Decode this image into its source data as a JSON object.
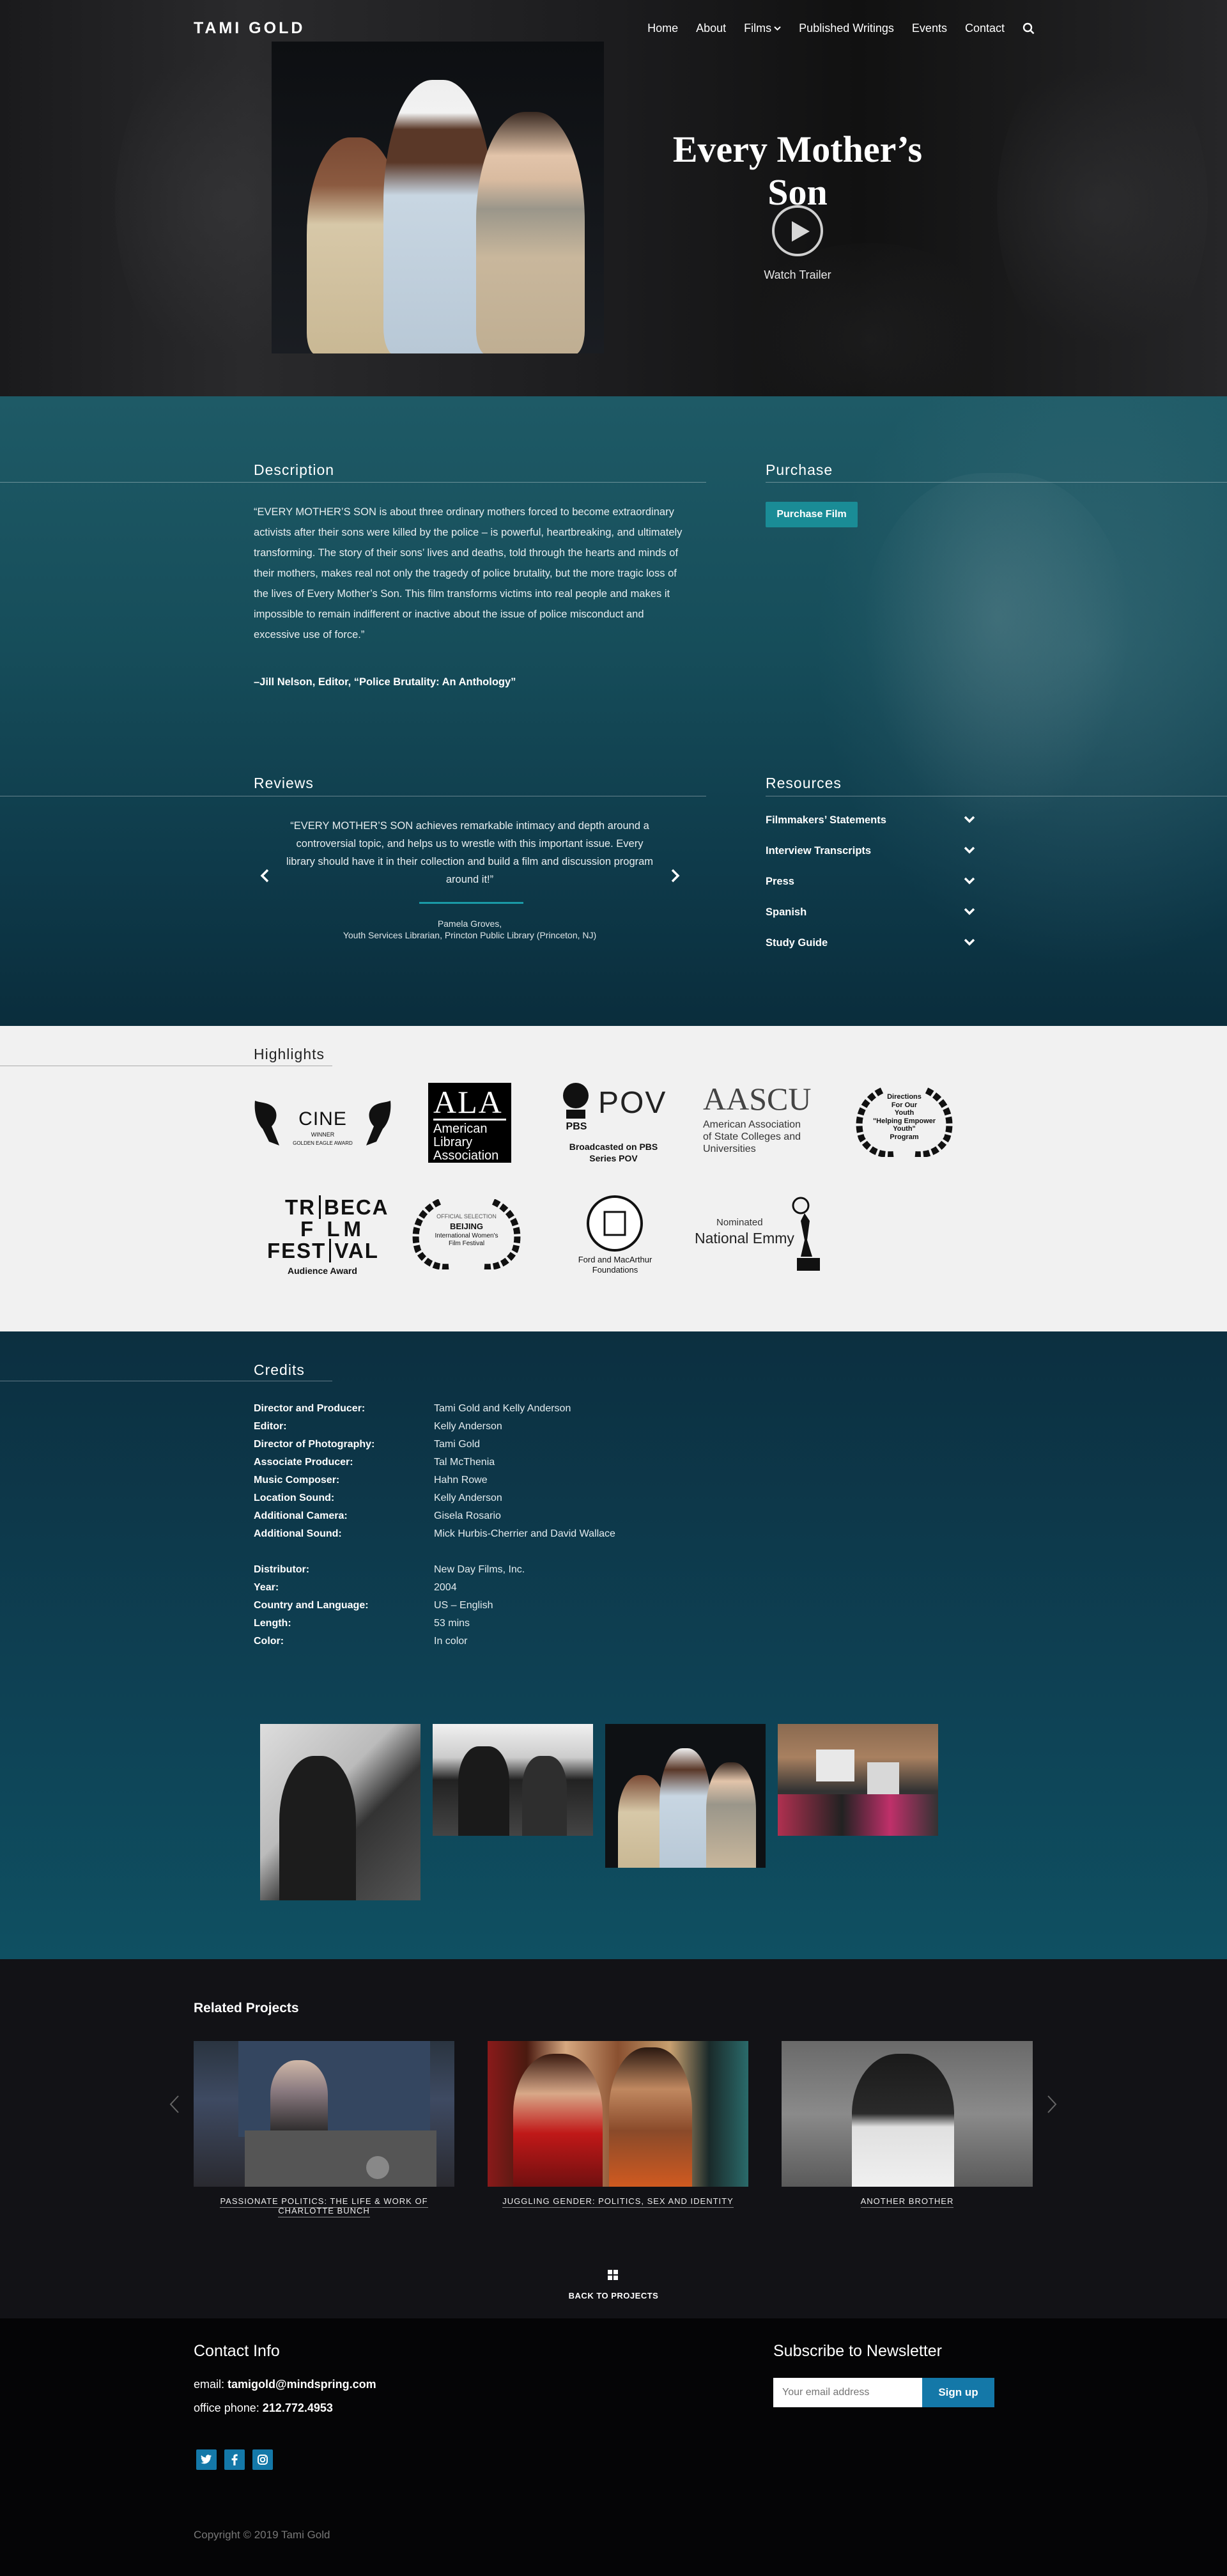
{
  "nav": {
    "logo": "TAMI GOLD",
    "links": [
      "Home",
      "About",
      "Films",
      "Published Writings",
      "Events",
      "Contact"
    ]
  },
  "hero": {
    "title": "Every Mother’s Son",
    "trailer_label": "Watch Trailer"
  },
  "description": {
    "heading": "Description",
    "text": "“EVERY MOTHER’S SON is about three ordinary mothers forced to become extraordinary activists after their sons were killed by the police – is powerful, heartbreaking, and ultimately transforming. The story of their sons’ lives and deaths, told through the hearts and minds of their mothers, makes real not only the tragedy of police brutality, but the more tragic loss of the lives of Every Mother’s Son. This film transforms victims into real people and makes it impossible to remain indifferent or inactive about the issue of police misconduct and excessive use of force.”",
    "cite": "–Jill Nelson, Editor, “Police Brutality: An Anthology”"
  },
  "purchase": {
    "heading": "Purchase",
    "button": "Purchase Film"
  },
  "reviews": {
    "heading": "Reviews",
    "quote": "“EVERY MOTHER’S SON achieves remarkable intimacy and depth around a controversial topic, and helps us to wrestle with this important issue. Every library should have it in their collection and build a film and discussion program around it!”",
    "author_name": "Pamela Groves,",
    "author_title": "Youth Services Librarian, Princton Public Library (Princeton, NJ)"
  },
  "resources": {
    "heading": "Resources",
    "items": [
      "Filmmakers’ Statements",
      "Interview Transcripts",
      "Press",
      "Spanish",
      "Study Guide"
    ]
  },
  "highlights": {
    "heading": "Highlights",
    "cine": {
      "name": "CINE",
      "line1": "WINNER",
      "line2": "GOLDEN EAGLE AWARD"
    },
    "ala": {
      "abbr": "ALA",
      "line1": "American",
      "line2": "Library",
      "line3": "Association"
    },
    "pov": {
      "pbs": "PBS",
      "pov": "POV",
      "line1": "Broadcasted on PBS",
      "line2": "Series POV"
    },
    "aascu": {
      "abbr": "AASCU",
      "line1": "American Association",
      "line2": "of State Colleges and",
      "line3": "Universities"
    },
    "directions": {
      "line1": "Directions",
      "line2": "For Our",
      "line3": "Youth",
      "line4": "\"Helping Empower",
      "line5": "Youth\"",
      "line6": "Program"
    },
    "tribeca": {
      "l1a": "TR",
      "l1b": "BECA",
      "l2": "F LM",
      "l3a": "FEST",
      "l3b": "VAL",
      "caption": "Audience Award"
    },
    "beijing": {
      "line1": "OFFICIAL SELECTION",
      "line2": "BEIJING",
      "line3": "International Women's",
      "line4": "Film Festival"
    },
    "ford": {
      "line1": "Ford and MacArthur",
      "line2": "Foundations"
    },
    "emmy": {
      "line1": "Nominated",
      "line2": "National Emmy"
    }
  },
  "credits": {
    "heading": "Credits",
    "rows": [
      {
        "label": "Director and Producer:",
        "value": "Tami Gold and Kelly Anderson"
      },
      {
        "label": "Editor:",
        "value": "Kelly Anderson"
      },
      {
        "label": "Director of Photography:",
        "value": "Tami Gold"
      },
      {
        "label": "Associate Producer:",
        "value": "Tal McThenia"
      },
      {
        "label": "Music Composer:",
        "value": "Hahn Rowe"
      },
      {
        "label": "Location Sound:",
        "value": "Kelly Anderson"
      },
      {
        "label": "Additional Camera:",
        "value": "Gisela Rosario"
      },
      {
        "label": "Additional Sound:",
        "value": "Mick Hurbis-Cherrier and David Wallace"
      }
    ],
    "rows2": [
      {
        "label": "Distributor:",
        "value": "New Day Films, Inc."
      },
      {
        "label": "Year:",
        "value": "2004"
      },
      {
        "label": "Country and Language:",
        "value": "US – English"
      },
      {
        "label": "Length:",
        "value": "53 mins"
      },
      {
        "label": "Color:",
        "value": "In color"
      }
    ]
  },
  "related": {
    "heading": "Related Projects",
    "items": [
      {
        "line1": "PASSIONATE POLITICS: THE LIFE & WORK OF",
        "line2": "CHARLOTTE BUNCH"
      },
      {
        "line1": "JUGGLING GENDER: POLITICS, SEX AND IDENTITY",
        "line2": ""
      },
      {
        "line1": "ANOTHER BROTHER",
        "line2": ""
      }
    ],
    "back": "BACK TO PROJECTS"
  },
  "footer": {
    "contact_heading": "Contact Info",
    "email_label": "email:",
    "email": "tamigold@mindspring.com",
    "phone_label": "office phone:",
    "phone": "212.772.4953",
    "newsletter_heading": "Subscribe to Newsletter",
    "email_placeholder": "Your email address",
    "signup": "Sign up",
    "copyright": "Copyright © 2019 Tami Gold"
  },
  "colors": {
    "teal": "#1a8c96",
    "blue": "#1478a8",
    "dark_teal": "#0e3a4a"
  }
}
